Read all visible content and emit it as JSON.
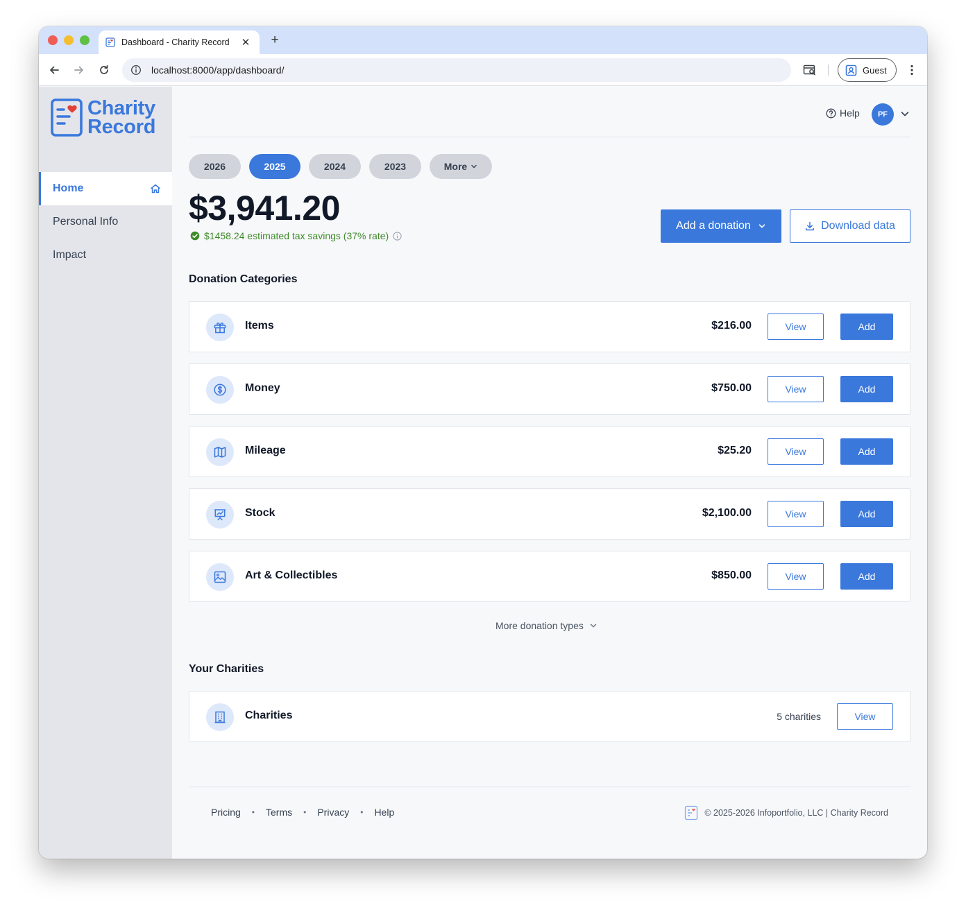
{
  "browser": {
    "tab_title": "Dashboard - Charity Record",
    "url": "localhost:8000/app/dashboard/",
    "profile_label": "Guest"
  },
  "sidebar": {
    "logo_line1": "Charity",
    "logo_line2": "Record",
    "items": [
      {
        "label": "Home",
        "active": true
      },
      {
        "label": "Personal Info",
        "active": false
      },
      {
        "label": "Impact",
        "active": false
      }
    ]
  },
  "header": {
    "help_label": "Help",
    "avatar_initials": "PF"
  },
  "years": [
    {
      "label": "2026",
      "active": false
    },
    {
      "label": "2025",
      "active": true
    },
    {
      "label": "2024",
      "active": false
    },
    {
      "label": "2023",
      "active": false
    },
    {
      "label": "More",
      "active": false
    }
  ],
  "summary": {
    "total": "$3,941.20",
    "tax_savings": "$1458.24 estimated tax savings (37% rate)"
  },
  "actions": {
    "add_donation": "Add a donation",
    "download_data": "Download data"
  },
  "categories": {
    "title": "Donation Categories",
    "view_label": "View",
    "add_label": "Add",
    "items": [
      {
        "name": "Items",
        "amount": "$216.00",
        "icon": "gift-icon"
      },
      {
        "name": "Money",
        "amount": "$750.00",
        "icon": "dollar-circle-icon"
      },
      {
        "name": "Mileage",
        "amount": "$25.20",
        "icon": "map-icon"
      },
      {
        "name": "Stock",
        "amount": "$2,100.00",
        "icon": "chart-presentation-icon"
      },
      {
        "name": "Art & Collectibles",
        "amount": "$850.00",
        "icon": "image-icon"
      }
    ],
    "more_label": "More donation types"
  },
  "charities": {
    "title": "Your Charities",
    "name": "Charities",
    "count": "5 charities",
    "view_label": "View"
  },
  "footer": {
    "links": [
      "Pricing",
      "Terms",
      "Privacy",
      "Help"
    ],
    "copyright": "© 2025-2026 Infoportfolio, LLC | Charity Record"
  },
  "colors": {
    "accent": "#3a78dc",
    "success": "#3f8a2b",
    "sidebar_bg": "#e4e5ea"
  }
}
